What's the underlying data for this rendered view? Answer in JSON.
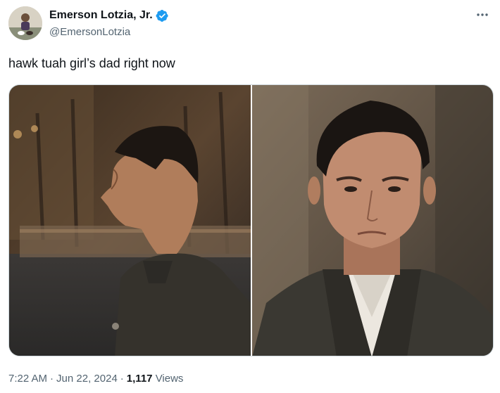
{
  "author": {
    "display_name": "Emerson Lotzia, Jr.",
    "handle": "@EmersonLotzia",
    "verified": true,
    "verified_color": "#1d9bf0"
  },
  "tweet": {
    "text": "hawk tuah girl’s dad right now"
  },
  "media": {
    "photos": [
      {
        "icon": "photo-man-profile-park"
      },
      {
        "icon": "photo-man-front-closeup"
      }
    ]
  },
  "meta": {
    "time": "7:22 AM",
    "date": "Jun 22, 2024",
    "separator": "·",
    "views_count": "1,117",
    "views_label": "Views"
  },
  "colors": {
    "text_primary": "#0f1419",
    "text_secondary": "#536471",
    "accent": "#1d9bf0"
  }
}
